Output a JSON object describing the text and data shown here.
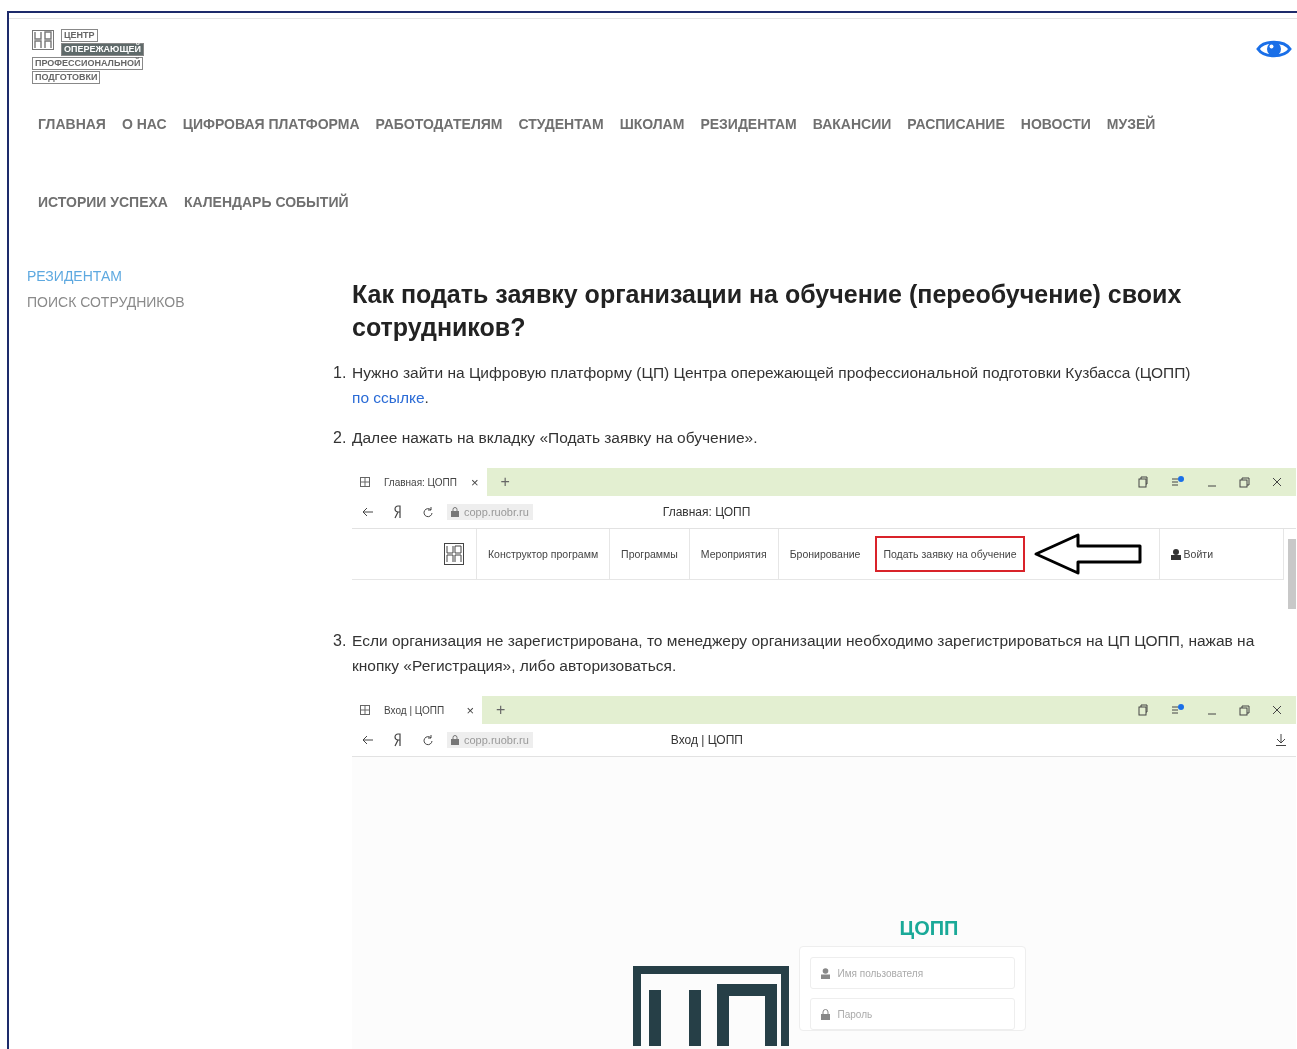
{
  "logo": {
    "lines": [
      "ЦЕНТР",
      "ОПЕРЕЖАЮЩЕЙ",
      "ПРОФЕССИОНАЛЬНОЙ",
      "ПОДГОТОВКИ"
    ]
  },
  "nav": [
    {
      "label": "ГЛАВНАЯ"
    },
    {
      "label": "О НАС"
    },
    {
      "label": "ЦИФРОВАЯ ПЛАТФОРМА"
    },
    {
      "label": "РАБОТОДАТЕЛЯМ"
    },
    {
      "label": "СТУДЕНТАМ"
    },
    {
      "label": "ШКОЛАМ"
    },
    {
      "label": "РЕЗИДЕНТАМ"
    },
    {
      "label": "ВАКАНСИИ"
    },
    {
      "label": "РАСПИСАНИЕ"
    },
    {
      "label": "НОВОСТИ"
    },
    {
      "label": "МУЗЕЙ"
    },
    {
      "label": "ИСТОРИИ УСПЕХА"
    },
    {
      "label": "КАЛЕНДАРЬ СОБЫТИЙ"
    }
  ],
  "sidebar": {
    "items": [
      {
        "label": "РЕЗИДЕНТАМ",
        "selected": true
      },
      {
        "label": "ПОИСК СОТРУДНИКОВ",
        "selected": false
      }
    ]
  },
  "article": {
    "title": "Как подать заявку организации на обучение (переобучение) своих сотрудников?",
    "steps": [
      {
        "number": "1.",
        "text": "Нужно зайти на Цифровую платформу (ЦП) Центра опережающей профессиональной подготовки Кузбасса (ЦОПП)",
        "link": "по ссылке",
        "after": "."
      },
      {
        "number": "2.",
        "text": "Далее нажать на вкладку «Подать заявку на обучение».",
        "screenshot": {
          "kind": "home",
          "tab": "Главная: ЦОПП",
          "close": "×",
          "plus": "+",
          "url": "copp.ruobr.ru",
          "page_title": "Главная: ЦОПП",
          "menu": [
            {
              "label": "Конструктор программ",
              "highlighted": false
            },
            {
              "label": "Программы",
              "highlighted": false
            },
            {
              "label": "Мероприятия",
              "highlighted": false
            },
            {
              "label": "Бронирование",
              "highlighted": false
            },
            {
              "label": "Подать заявку на обучение",
              "highlighted": true
            }
          ],
          "login": "Войти"
        }
      },
      {
        "number": "3.",
        "text": "Если организация не зарегистрирована, то менеджеру организации необходимо зарегистрироваться на ЦП ЦОПП, нажав на кнопку «Регистрация», либо авторизоваться.",
        "screenshot": {
          "kind": "login",
          "tab": "Вход | ЦОПП",
          "close": "×",
          "plus": "+",
          "url": "copp.ruobr.ru",
          "page_title": "Вход | ЦОПП",
          "brand": "ЦОПП",
          "fields": [
            {
              "kind": "user",
              "placeholder": "Имя пользователя"
            },
            {
              "kind": "lock",
              "placeholder": "Пароль"
            }
          ]
        }
      }
    ]
  }
}
